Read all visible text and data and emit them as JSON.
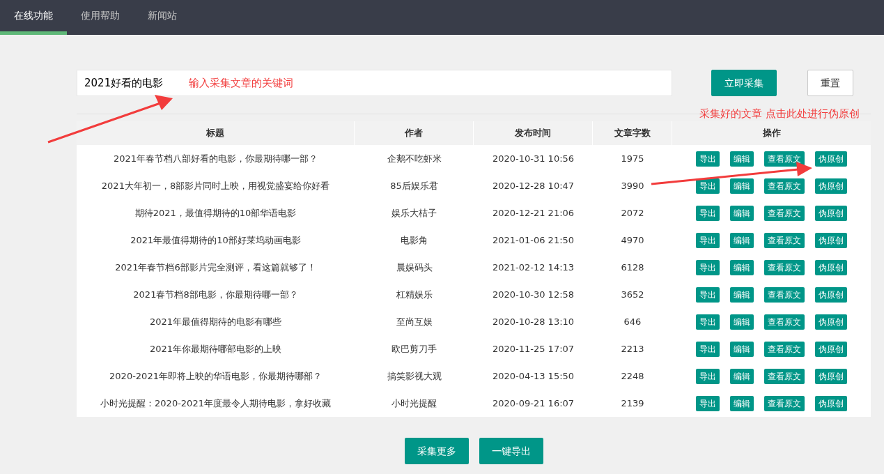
{
  "nav": {
    "tabs": [
      {
        "label": "在线功能",
        "selected": true
      },
      {
        "label": "使用帮助",
        "selected": false
      },
      {
        "label": "新闻站",
        "selected": false
      }
    ]
  },
  "search": {
    "value": "2021好看的电影",
    "buttons": [
      {
        "label": "立即采集",
        "kind": "primary"
      },
      {
        "label": "重置",
        "kind": "plain"
      }
    ]
  },
  "annotations": [
    {
      "text": "输入采集文章的关键词"
    },
    {
      "text": "采集好的文章 点击此处进行伪原创"
    }
  ],
  "table": {
    "columns": [
      "标题",
      "作者",
      "发布时间",
      "文章字数",
      "操作"
    ],
    "rows": [
      {
        "title": "2021年春节档八部好看的电影，你最期待哪一部？",
        "author": "企鹅不吃虾米",
        "time": "2020-10-31 10:56",
        "words": "1975",
        "actions": [
          "导出",
          "编辑",
          "查看原文",
          "伪原创"
        ]
      },
      {
        "title": "2021大年初一，8部影片同时上映，用视觉盛宴给你好看",
        "author": "85后娱乐君",
        "time": "2020-12-28 10:47",
        "words": "3990",
        "actions": [
          "导出",
          "编辑",
          "查看原文",
          "伪原创"
        ]
      },
      {
        "title": "期待2021，最值得期待的10部华语电影",
        "author": "娱乐大桔子",
        "time": "2020-12-21 21:06",
        "words": "2072",
        "actions": [
          "导出",
          "编辑",
          "查看原文",
          "伪原创"
        ]
      },
      {
        "title": "2021年最值得期待的10部好莱坞动画电影",
        "author": "电影角",
        "time": "2021-01-06 21:50",
        "words": "4970",
        "actions": [
          "导出",
          "编辑",
          "查看原文",
          "伪原创"
        ]
      },
      {
        "title": "2021年春节档6部影片完全测评，看这篇就够了！",
        "author": "晨娱码头",
        "time": "2021-02-12 14:13",
        "words": "6128",
        "actions": [
          "导出",
          "编辑",
          "查看原文",
          "伪原创"
        ]
      },
      {
        "title": "2021春节档8部电影，你最期待哪一部？",
        "author": "杠精娱乐",
        "time": "2020-10-30 12:58",
        "words": "3652",
        "actions": [
          "导出",
          "编辑",
          "查看原文",
          "伪原创"
        ]
      },
      {
        "title": "2021年最值得期待的电影有哪些",
        "author": "至尚互娱",
        "time": "2020-10-28 13:10",
        "words": "646",
        "actions": [
          "导出",
          "编辑",
          "查看原文",
          "伪原创"
        ]
      },
      {
        "title": "2021年你最期待哪部电影的上映",
        "author": "欧巴剪刀手",
        "time": "2020-11-25 17:07",
        "words": "2213",
        "actions": [
          "导出",
          "编辑",
          "查看原文",
          "伪原创"
        ]
      },
      {
        "title": "2020-2021年即将上映的华语电影，你最期待哪部？",
        "author": "搞笑影视大观",
        "time": "2020-04-13 15:50",
        "words": "2248",
        "actions": [
          "导出",
          "编辑",
          "查看原文",
          "伪原创"
        ]
      },
      {
        "title": "小时光提醒：2020-2021年度最令人期待电影，拿好收藏",
        "author": "小时光提醒",
        "time": "2020-09-21 16:07",
        "words": "2139",
        "actions": [
          "导出",
          "编辑",
          "查看原文",
          "伪原创"
        ]
      }
    ]
  },
  "footer_buttons": [
    "采集更多",
    "一键导出"
  ]
}
